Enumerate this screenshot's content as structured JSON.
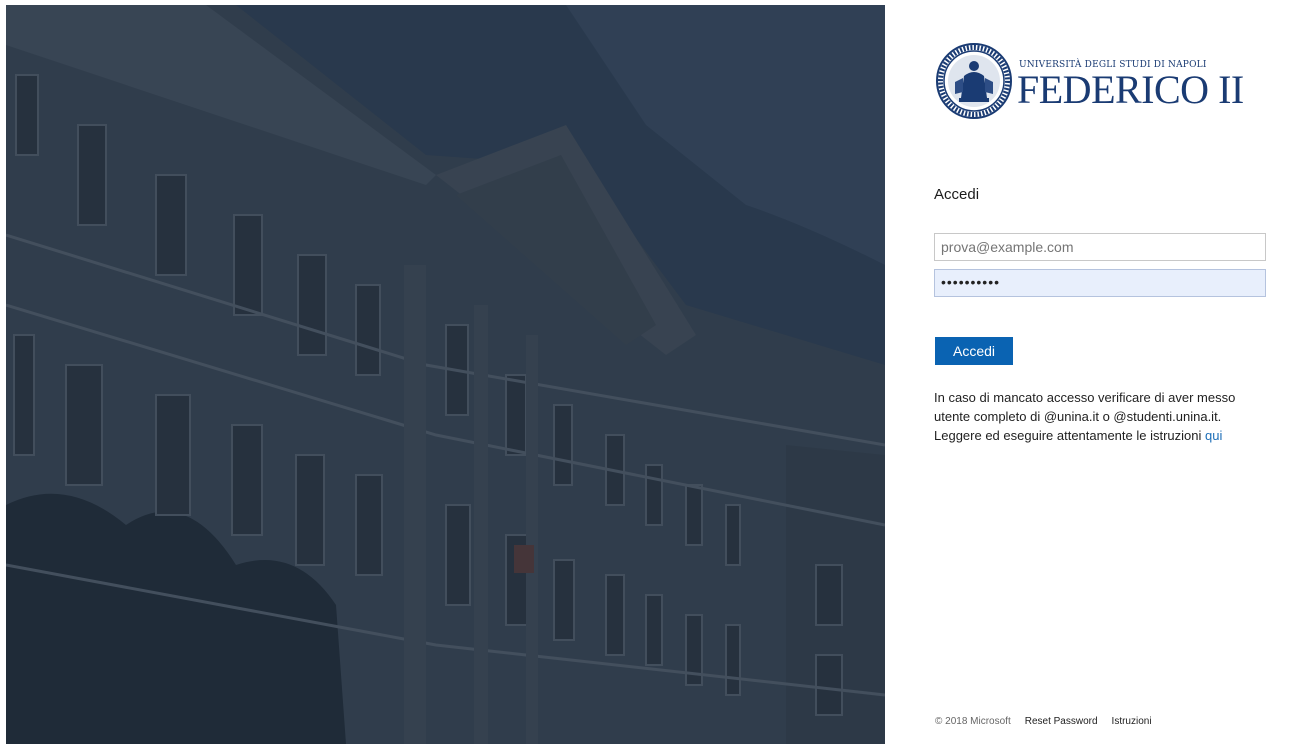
{
  "brand": {
    "line1": "UNIVERSITÀ DEGLI STUDI DI NAPOLI",
    "line2": "FEDERICO II",
    "color": "#1a3b73"
  },
  "login": {
    "title": "Accedi",
    "email_placeholder": "prova@example.com",
    "password_value": "••••••••••",
    "submit_label": "Accedi",
    "button_color": "#0a63b2"
  },
  "info": {
    "line1": "In caso di mancato accesso verificare di aver messo",
    "line2": "utente completo di @unina.it o @studenti.unina.it.",
    "line3": "Leggere ed eseguire attentamente le istruzioni",
    "link_label": "qui"
  },
  "footer": {
    "copyright": "© 2018 Microsoft",
    "reset_password": "Reset Password",
    "instructions": "Istruzioni"
  },
  "background": {
    "icon": "university-building-photo"
  }
}
